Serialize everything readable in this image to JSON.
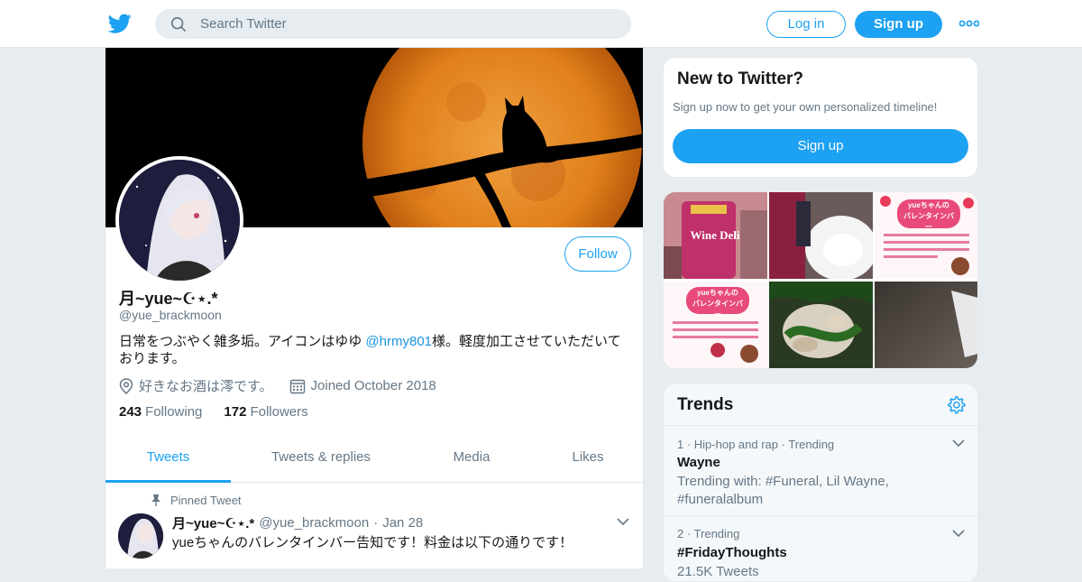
{
  "topbar": {
    "search_placeholder": "Search Twitter",
    "login_label": "Log in",
    "signup_label": "Sign up"
  },
  "profile": {
    "display_name": "月~yue~☪︎⋆.*",
    "handle": "@yue_brackmoon",
    "bio_pre": "日常をつぶやく雑多垢。アイコンはゆゆ ",
    "bio_mention": "@hrmy801",
    "bio_post": "様。軽度加工させていただいております。",
    "location": "好きなお酒は澪です。",
    "joined": "Joined October 2018",
    "following_count": "243",
    "following_label": "Following",
    "followers_count": "172",
    "followers_label": "Followers",
    "follow_label": "Follow"
  },
  "tabs": [
    {
      "label": "Tweets"
    },
    {
      "label": "Tweets & replies"
    },
    {
      "label": "Media"
    },
    {
      "label": "Likes"
    }
  ],
  "pinned_tweet": {
    "pinned_label": "Pinned Tweet",
    "name": "月~yue~☪︎⋆.*",
    "handle": "@yue_brackmoon",
    "date": "Jan 28",
    "text": "yueちゃんのバレンタインバー告知です！料金は以下の通りです！"
  },
  "new_to_twitter": {
    "title": "New to Twitter?",
    "subtitle": "Sign up now to get your own personalized timeline!",
    "signup_label": "Sign up"
  },
  "media_thumbs": {
    "t1": "Wine Deli",
    "t3_title1": "yueちゃんの",
    "t3_title2": "バレンタインバー",
    "t4_title1": "yueちゃんの",
    "t4_title2": "バレンタインバー"
  },
  "trends": {
    "title": "Trends",
    "items": [
      {
        "context": "1 · Hip-hop and rap · Trending",
        "name": "Wayne",
        "desc": "Trending with: #Funeral, Lil Wayne, #funeralalbum"
      },
      {
        "context": "2 · Trending",
        "name": "#FridayThoughts",
        "desc": "21.5K Tweets"
      }
    ]
  },
  "colors": {
    "accent": "#1da1f2",
    "background": "#e6ecf0",
    "secondary_text": "#657786"
  }
}
